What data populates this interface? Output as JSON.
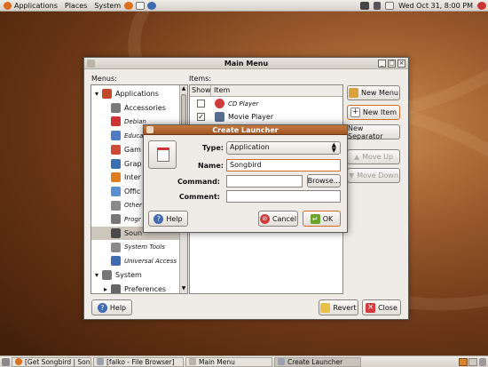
{
  "top_panel": {
    "menus": [
      "Applications",
      "Places",
      "System"
    ],
    "clock": "Wed Oct 31,  8:00 PM"
  },
  "main_window": {
    "title": "Main Menu",
    "menus_label": "Menus:",
    "items_label": "Items:",
    "tree": [
      {
        "label": "Applications",
        "level": 0,
        "expanded": true,
        "italic": false
      },
      {
        "label": "Accessories",
        "level": 1,
        "italic": false
      },
      {
        "label": "Debian",
        "level": 1,
        "italic": true
      },
      {
        "label": "Educa",
        "level": 1,
        "italic": true
      },
      {
        "label": "Gam",
        "level": 1,
        "italic": false
      },
      {
        "label": "Grap",
        "level": 1,
        "italic": false
      },
      {
        "label": "Inter",
        "level": 1,
        "italic": false
      },
      {
        "label": "Offic",
        "level": 1,
        "italic": false
      },
      {
        "label": "Other",
        "level": 1,
        "italic": true
      },
      {
        "label": "Progr",
        "level": 1,
        "italic": true
      },
      {
        "label": "Soun",
        "level": 1,
        "italic": false,
        "selected": true
      },
      {
        "label": "System Tools",
        "level": 1,
        "italic": true
      },
      {
        "label": "Universal Access",
        "level": 1,
        "italic": true
      },
      {
        "label": "System",
        "level": 0,
        "expanded": true,
        "italic": false
      },
      {
        "label": "Preferences",
        "level": 1,
        "italic": false
      }
    ],
    "items_columns": [
      "Show",
      "Item"
    ],
    "items": [
      {
        "label": "CD Player",
        "checked": false,
        "italic": true
      },
      {
        "label": "Movie Player",
        "checked": true,
        "italic": false
      }
    ],
    "buttons": {
      "new_menu": "New Menu",
      "new_item": "New Item",
      "new_separator": "New Separator",
      "move_up": "Move Up",
      "move_down": "Move Down",
      "help": "Help",
      "revert": "Revert",
      "close": "Close"
    }
  },
  "dialog": {
    "title": "Create Launcher",
    "type_label": "Type:",
    "type_value": "Application",
    "name_label": "Name:",
    "name_value": "Songbird",
    "command_label": "Command:",
    "command_value": "",
    "browse": "Browse...",
    "comment_label": "Comment:",
    "comment_value": "",
    "help": "Help",
    "cancel": "Cancel",
    "ok": "OK"
  },
  "taskbar": [
    {
      "label": "[Get Songbird | Song...",
      "active": false
    },
    {
      "label": "[falko - File Browser]",
      "active": false
    },
    {
      "label": "Main Menu",
      "active": false
    },
    {
      "label": "Create Launcher",
      "active": true
    }
  ],
  "colors": {
    "accent": "#d06a28",
    "selection": "#cdc6bd",
    "desktop": "#8a4a20"
  }
}
